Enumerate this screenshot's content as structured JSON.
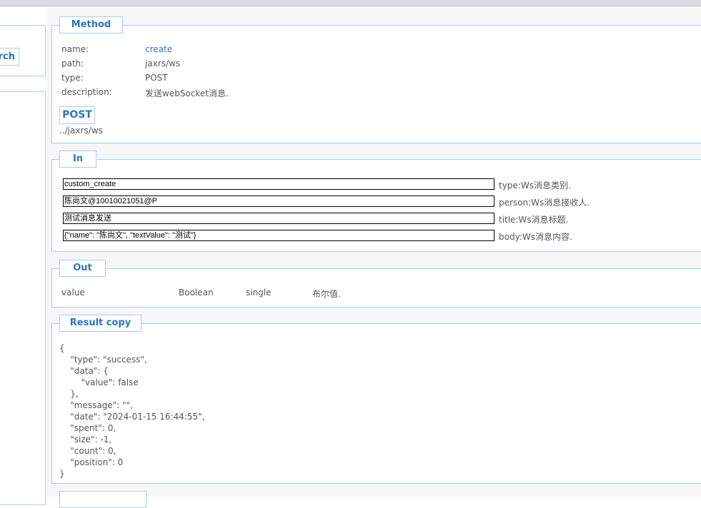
{
  "sidebar": {
    "search_label": "rch"
  },
  "method": {
    "legend": "Method",
    "fields": [
      {
        "label": "name:",
        "value": "create"
      },
      {
        "label": "path:",
        "value": "jaxrs/ws"
      },
      {
        "label": "type:",
        "value": "POST"
      },
      {
        "label": "description:",
        "value": "发送webSocket消息."
      }
    ],
    "post_button": "POST",
    "url": "../jaxrs/ws"
  },
  "in": {
    "legend": "In",
    "params": [
      {
        "value": "custom_create",
        "label": "type:Ws消息类别."
      },
      {
        "value": "陈尚文@10010021051@P",
        "label": "person:Ws消息接收人."
      },
      {
        "value": "测试消息发送",
        "label": "title:Ws消息标题."
      },
      {
        "value": "{\"name\": \"陈尚文\", \"textValue\": \"测试\"}",
        "label": "body:Ws消息内容."
      }
    ]
  },
  "out": {
    "legend": "Out",
    "name": "value",
    "type": "Boolean",
    "multiplicity": "single",
    "description": "布尔值."
  },
  "result": {
    "legend": "Result copy",
    "json": "{\n    \"type\": \"success\",\n    \"data\": {\n        \"value\": false\n    },\n    \"message\": \"\",\n    \"date\": \"2024-01-15 16:44:55\",\n    \"spent\": 0,\n    \"size\": -1,\n    \"count\": 0,\n    \"position\": 0\n}"
  }
}
